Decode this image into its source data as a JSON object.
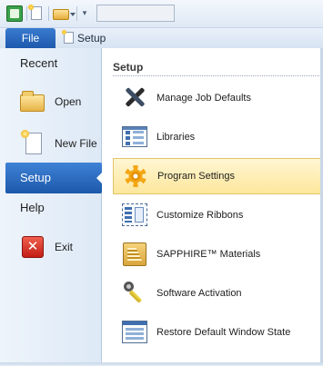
{
  "ribbon": {
    "file_tab": "File",
    "setup_tab": "Setup"
  },
  "backstage_nav": {
    "recent": "Recent",
    "open": "Open",
    "new_file": "New File",
    "setup": "Setup",
    "help": "Help",
    "exit": "Exit"
  },
  "main": {
    "section_title": "Setup",
    "items": [
      {
        "label": "Manage Job Defaults",
        "icon": "tools-icon"
      },
      {
        "label": "Libraries",
        "icon": "library-grid-icon"
      },
      {
        "label": "Program Settings",
        "icon": "gear-icon"
      },
      {
        "label": "Customize Ribbons",
        "icon": "ribbon-icon"
      },
      {
        "label": "SAPPHIRE™ Materials",
        "icon": "materials-icon"
      },
      {
        "label": "Software Activation",
        "icon": "key-icon"
      },
      {
        "label": "Restore Default Window State",
        "icon": "window-icon"
      }
    ]
  },
  "colors": {
    "file_tab": "#2a6bc2",
    "selected_nav": "#2a6bc2",
    "hover_item": "#fde79c"
  }
}
